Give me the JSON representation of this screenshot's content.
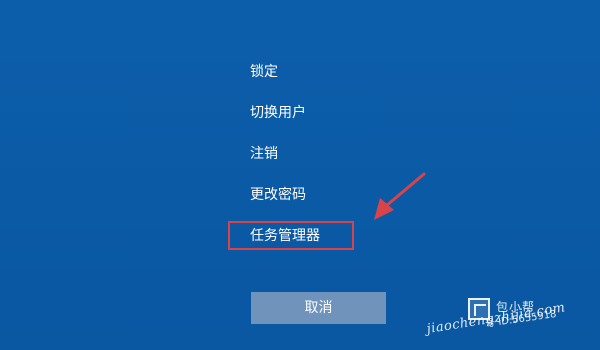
{
  "menu": {
    "items": [
      {
        "label": "锁定"
      },
      {
        "label": "切换用户"
      },
      {
        "label": "注销"
      },
      {
        "label": "更改密码"
      },
      {
        "label": "任务管理器"
      }
    ]
  },
  "cancel_button": {
    "label": "取消"
  },
  "watermark": {
    "name_text": "包小帮",
    "id_text": "号 ID:5655918",
    "url_text": "jiaochengzhijia.com"
  },
  "colors": {
    "background": "#0b5aa6",
    "highlight_border": "#d9434a",
    "arrow": "#d9434a",
    "cancel_button_bg": "#6f93bb",
    "text": "#ffffff"
  },
  "icons": {
    "annotation_arrow": "arrow-pointer-icon",
    "watermark_logo": "watermark-logo-icon"
  }
}
